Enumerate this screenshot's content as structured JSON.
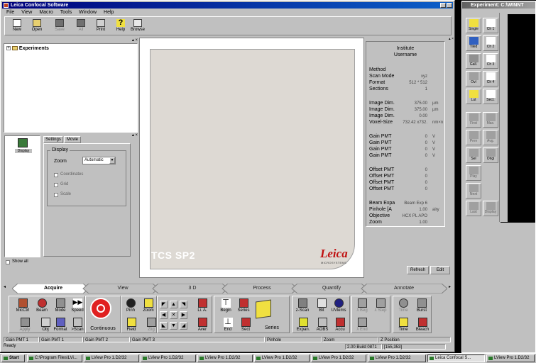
{
  "window": {
    "title": "Leica Confocal Software"
  },
  "menu": [
    "File",
    "View",
    "Macro",
    "Tools",
    "Window",
    "Help"
  ],
  "toolbar": [
    "New",
    "Open",
    "Save",
    "All",
    "Print",
    "Help",
    "Browse"
  ],
  "tree": {
    "root": "Experiments"
  },
  "left_panel": {
    "icon_label": "Display",
    "tabs": [
      "Settings",
      "Movie"
    ],
    "group": "Display",
    "zoom_label": "Zoom",
    "zoom_value": "Automatic",
    "checks": [
      "Coordinates",
      "Grid",
      "Scale"
    ],
    "show_all": "Show all"
  },
  "image": {
    "product": "TCS SP2",
    "brand": "Leica",
    "brand_sub": "MICROSYSTEMS"
  },
  "info": {
    "institute": "Institute",
    "username": "Username",
    "rows": [
      {
        "label": "Method",
        "value": "",
        "unit": "",
        "y": 95
      },
      {
        "label": "Scan Mode",
        "value": "xyz",
        "unit": "",
        "y": 104
      },
      {
        "label": "Format",
        "value": "512 * 512",
        "unit": "",
        "y": 113
      },
      {
        "label": "Sections",
        "value": "1",
        "unit": "",
        "y": 122
      },
      {
        "label": "Image Dim.",
        "value": "375.00",
        "unit": "µm",
        "y": 142
      },
      {
        "label": "Image Dim.",
        "value": "375.00",
        "unit": "µm",
        "y": 151
      },
      {
        "label": "Image Dim.",
        "value": "0.00",
        "unit": "",
        "y": 160
      },
      {
        "label": "Voxel-Size",
        "value": "732.42 x732.",
        "unit": "nm×n",
        "y": 169
      },
      {
        "label": "Gain PMT",
        "value": "0",
        "unit": "V",
        "y": 189
      },
      {
        "label": "Gain PMT",
        "value": "0",
        "unit": "V",
        "y": 198
      },
      {
        "label": "Gain PMT",
        "value": "0",
        "unit": "V",
        "y": 207
      },
      {
        "label": "Gain PMT",
        "value": "0",
        "unit": "V",
        "y": 216
      },
      {
        "label": "Offset PMT",
        "value": "0",
        "unit": "",
        "y": 236
      },
      {
        "label": "Offset PMT",
        "value": "0",
        "unit": "",
        "y": 245
      },
      {
        "label": "Offset PMT",
        "value": "0",
        "unit": "",
        "y": 254
      },
      {
        "label": "Offset PMT",
        "value": "0",
        "unit": "",
        "y": 263
      },
      {
        "label": "Beam Expa",
        "value": "Beam Exp 6",
        "unit": "",
        "y": 283
      },
      {
        "label": "Pinhole [A",
        "value": "1.00",
        "unit": "airy",
        "y": 292
      },
      {
        "label": "Objective",
        "value": "HCX PL APO",
        "unit": "",
        "y": 301
      },
      {
        "label": "Zoom",
        "value": "1.00",
        "unit": "",
        "y": 310
      }
    ],
    "refresh": "Refresh",
    "edit": "Edit"
  },
  "tabs": [
    "Acquire",
    "View",
    "3 D",
    "Process",
    "Quantify",
    "Annotate"
  ],
  "acquire": {
    "small": [
      "MicCtrl",
      "Beam",
      "Mode",
      "Speed",
      "Apply",
      "Obj",
      "Format",
      ">Scan"
    ],
    "continuous": "Continuous",
    "pinh": [
      "Pinh",
      "Zoom",
      "Field",
      "Zlig"
    ],
    "li": [
      "Li. A.",
      "Aver"
    ],
    "begin": [
      "Begin",
      "Series",
      "End",
      "Sect"
    ],
    "series": "Series",
    "zscan": [
      "z-Scan",
      "Bit",
      "UVlems",
      "Expan.",
      "AOBS",
      "Accu"
    ],
    "lambda": [
      "λ Beg",
      "λ Step",
      "λ End"
    ],
    "time": [
      "Time",
      "Burst",
      "Time",
      "Bleach"
    ]
  },
  "status_fields": [
    "Gain PMT 1",
    "Gain PMT 2",
    "Gain PMT 3",
    "Pinhole",
    "Zoom",
    "Z Position"
  ],
  "statusbar": {
    "ready": "Ready",
    "build": "2.00 Build 0871",
    "coord": "[155,353]"
  },
  "taskbar": {
    "start": "Start",
    "items": [
      "C:\\Program Files\\LVi...",
      "LView Pro 1.D2/32",
      "LView Pro 1.D2/32",
      "LView Pro 1.D2/32",
      "LView Pro 1.D2/32",
      "LView Pro 1.D2/32",
      "LView Pro 1.D2/32",
      "Leica Confocal S...",
      "LView Pro 1.D2/32"
    ]
  },
  "experiment": {
    "title": "Experiment: C:\\WINNT",
    "buttons": [
      [
        "Single",
        "Ch 1"
      ],
      [
        "Tiled",
        "Ch 2"
      ],
      [
        "Gall.",
        "Ch 3"
      ],
      [
        "Ovl",
        "Ch 4"
      ],
      [
        "Lut",
        "Sect."
      ],
      [
        "First",
        "Max."
      ],
      [
        "Prev",
        "Avg."
      ],
      [
        "Sel",
        "Origi"
      ],
      [
        "Play",
        ""
      ],
      [
        "Next",
        ""
      ],
      [
        "Last",
        "Display"
      ]
    ]
  }
}
